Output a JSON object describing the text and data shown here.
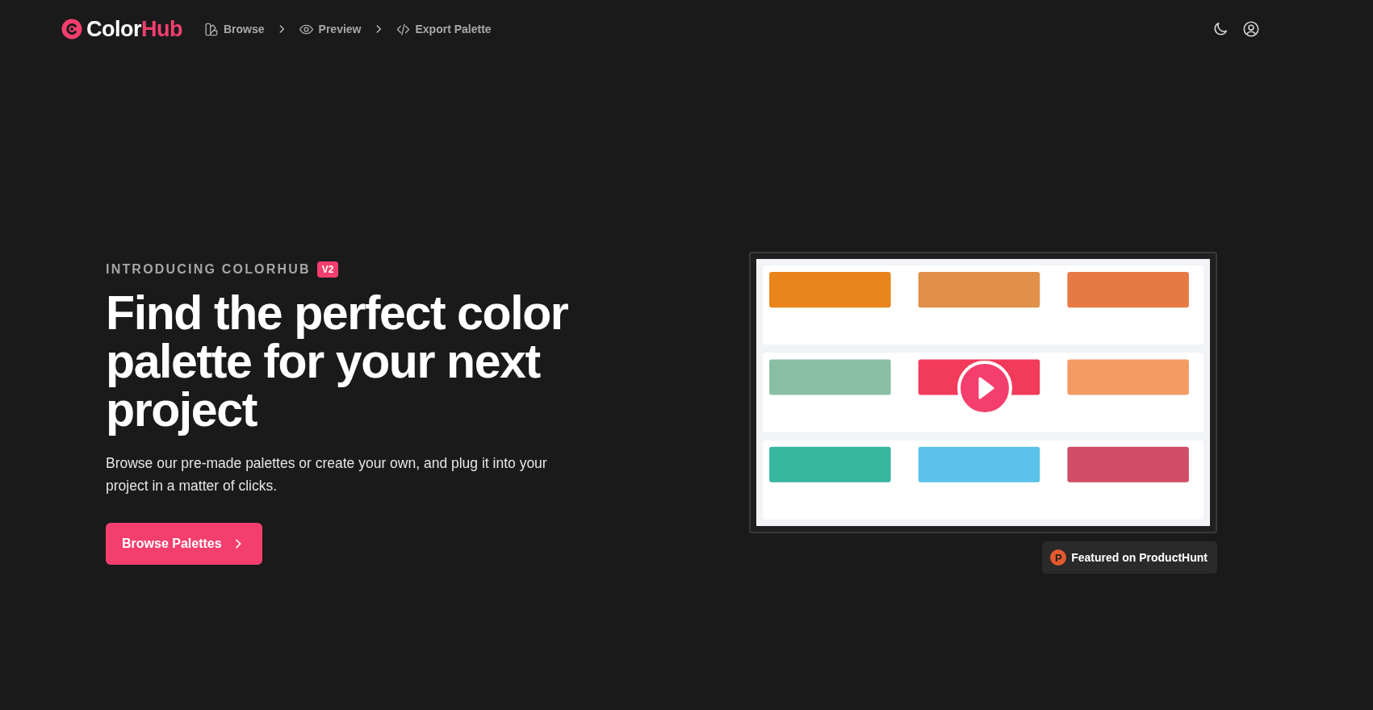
{
  "header": {
    "logo": {
      "prefix": "Color",
      "suffix": "Hub"
    },
    "nav": [
      {
        "label": "Browse",
        "kind": "swatch"
      },
      {
        "label": "Preview",
        "kind": "eye"
      },
      {
        "label": "Export Palette",
        "kind": "code"
      }
    ]
  },
  "hero": {
    "eyebrow": "INTRODUCING COLORHUB",
    "badge": "V2",
    "title": "Find the perfect color palette for your next project",
    "description": "Browse our pre-made palettes or create your own, and plug it into your project in a matter of clicks.",
    "cta": "Browse Palettes"
  },
  "featured": {
    "letter": "P",
    "label": "Featured on ProductHunt"
  }
}
